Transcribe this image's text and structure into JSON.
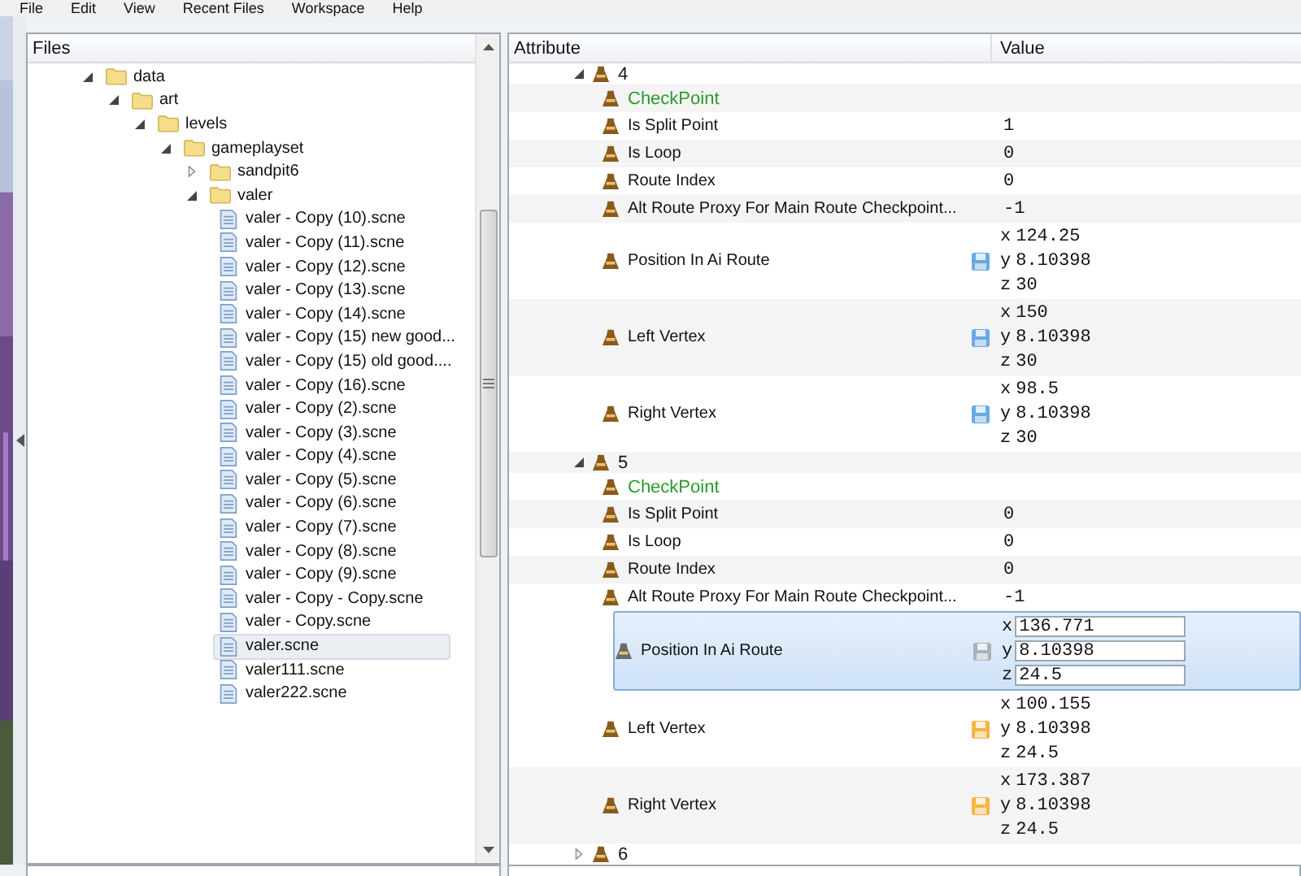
{
  "menu": [
    "File",
    "Edit",
    "View",
    "Recent Files",
    "Workspace",
    "Help"
  ],
  "files_panel": {
    "title": "Files",
    "tree": [
      {
        "name": "data",
        "kind": "folder",
        "expanded": true,
        "children": [
          {
            "name": "art",
            "kind": "folder",
            "expanded": true,
            "children": [
              {
                "name": "levels",
                "kind": "folder",
                "expanded": true,
                "children": [
                  {
                    "name": "gameplayset",
                    "kind": "folder",
                    "expanded": true,
                    "children": [
                      {
                        "name": "sandpit6",
                        "kind": "folder",
                        "expanded": false
                      },
                      {
                        "name": "valer",
                        "kind": "folder",
                        "expanded": true,
                        "children": [
                          {
                            "name": "valer - Copy (10).scne",
                            "kind": "file",
                            "selected": false
                          },
                          {
                            "name": "valer - Copy (11).scne",
                            "kind": "file",
                            "selected": false
                          },
                          {
                            "name": "valer - Copy (12).scne",
                            "kind": "file",
                            "selected": false
                          },
                          {
                            "name": "valer - Copy (13).scne",
                            "kind": "file",
                            "selected": false
                          },
                          {
                            "name": "valer - Copy (14).scne",
                            "kind": "file",
                            "selected": false
                          },
                          {
                            "name": "valer - Copy (15) new good...",
                            "kind": "file",
                            "selected": false
                          },
                          {
                            "name": "valer - Copy (15) old good....",
                            "kind": "file",
                            "selected": false
                          },
                          {
                            "name": "valer - Copy (16).scne",
                            "kind": "file",
                            "selected": false
                          },
                          {
                            "name": "valer - Copy (2).scne",
                            "kind": "file",
                            "selected": false
                          },
                          {
                            "name": "valer - Copy (3).scne",
                            "kind": "file",
                            "selected": false
                          },
                          {
                            "name": "valer - Copy (4).scne",
                            "kind": "file",
                            "selected": false
                          },
                          {
                            "name": "valer - Copy (5).scne",
                            "kind": "file",
                            "selected": false
                          },
                          {
                            "name": "valer - Copy (6).scne",
                            "kind": "file",
                            "selected": false
                          },
                          {
                            "name": "valer - Copy (7).scne",
                            "kind": "file",
                            "selected": false
                          },
                          {
                            "name": "valer - Copy (8).scne",
                            "kind": "file",
                            "selected": false
                          },
                          {
                            "name": "valer - Copy (9).scne",
                            "kind": "file",
                            "selected": false
                          },
                          {
                            "name": "valer - Copy - Copy.scne",
                            "kind": "file",
                            "selected": false
                          },
                          {
                            "name": "valer - Copy.scne",
                            "kind": "file",
                            "selected": false
                          },
                          {
                            "name": "valer.scne",
                            "kind": "file",
                            "selected": true
                          },
                          {
                            "name": "valer111.scne",
                            "kind": "file",
                            "selected": false
                          },
                          {
                            "name": "valer222.scne",
                            "kind": "file",
                            "selected": false
                          }
                        ]
                      }
                    ]
                  }
                ]
              }
            ]
          }
        ]
      }
    ]
  },
  "attributes_panel": {
    "columns": [
      "Attribute",
      "Value"
    ],
    "groups": [
      {
        "label": "4",
        "expanded": true,
        "rows": [
          {
            "kind": "heading",
            "label": "CheckPoint"
          },
          {
            "kind": "scalar",
            "label": "Is Split Point",
            "value": "1",
            "selected": false
          },
          {
            "kind": "scalar",
            "label": "Is Loop",
            "value": "0",
            "selected": false
          },
          {
            "kind": "scalar",
            "label": "Route Index",
            "value": "0",
            "selected": false
          },
          {
            "kind": "scalar",
            "label": "Alt Route Proxy For Main Route Checkpoint...",
            "value": "-1",
            "selected": false
          },
          {
            "kind": "vector",
            "label": "Position In Ai Route",
            "color": "#6aa8e2",
            "selected": false,
            "components": [
              {
                "axis": "x",
                "value": "124.25"
              },
              {
                "axis": "y",
                "value": "8.10398"
              },
              {
                "axis": "z",
                "value": "30"
              }
            ]
          },
          {
            "kind": "vector",
            "label": "Left Vertex",
            "color": "#6aa8e2",
            "selected": false,
            "components": [
              {
                "axis": "x",
                "value": "150"
              },
              {
                "axis": "y",
                "value": "8.10398"
              },
              {
                "axis": "z",
                "value": "30"
              }
            ]
          },
          {
            "kind": "vector",
            "label": "Right Vertex",
            "color": "#6aa8e2",
            "selected": false,
            "components": [
              {
                "axis": "x",
                "value": "98.5"
              },
              {
                "axis": "y",
                "value": "8.10398"
              },
              {
                "axis": "z",
                "value": "30"
              }
            ]
          }
        ]
      },
      {
        "label": "5",
        "expanded": true,
        "rows": [
          {
            "kind": "heading",
            "label": "CheckPoint"
          },
          {
            "kind": "scalar",
            "label": "Is Split Point",
            "value": "0",
            "selected": false
          },
          {
            "kind": "scalar",
            "label": "Is Loop",
            "value": "0",
            "selected": false
          },
          {
            "kind": "scalar",
            "label": "Route Index",
            "value": "0",
            "selected": false
          },
          {
            "kind": "scalar",
            "label": "Alt Route Proxy For Main Route Checkpoint...",
            "value": "-1",
            "selected": false
          },
          {
            "kind": "vector",
            "label": "Position In Ai Route",
            "color": "#a9b2ba",
            "selected": true,
            "components": [
              {
                "axis": "x",
                "value": "136.771"
              },
              {
                "axis": "y",
                "value": "8.10398"
              },
              {
                "axis": "z",
                "value": "24.5"
              }
            ]
          },
          {
            "kind": "vector",
            "label": "Left Vertex",
            "color": "#f4b545",
            "selected": false,
            "components": [
              {
                "axis": "x",
                "value": "100.155"
              },
              {
                "axis": "y",
                "value": "8.10398"
              },
              {
                "axis": "z",
                "value": "24.5"
              }
            ]
          },
          {
            "kind": "vector",
            "label": "Right Vertex",
            "color": "#f4b545",
            "selected": false,
            "components": [
              {
                "axis": "x",
                "value": "173.387"
              },
              {
                "axis": "y",
                "value": "8.10398"
              },
              {
                "axis": "z",
                "value": "24.5"
              }
            ]
          }
        ]
      },
      {
        "label": "6",
        "expanded": false
      }
    ]
  }
}
